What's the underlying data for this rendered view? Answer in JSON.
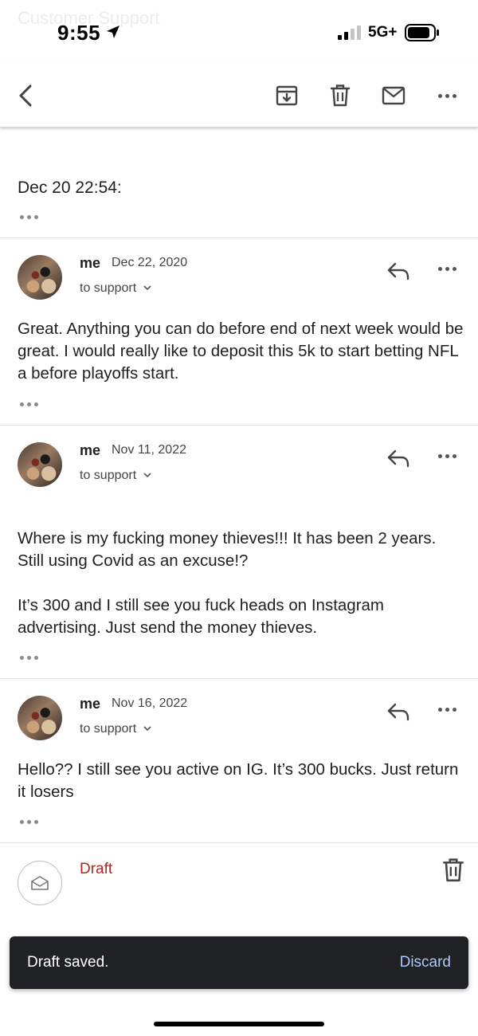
{
  "window": {
    "ghost_title": "Customer Support"
  },
  "status_bar": {
    "time": "9:55",
    "network": "5G+"
  },
  "toolbar": {
    "icons": [
      "back-arrow-icon",
      "archive-icon",
      "trash-icon",
      "mail-icon",
      "more-icon"
    ]
  },
  "thread": {
    "collapsed_header": "Dec 20 22:54:",
    "messages": [
      {
        "sender": "me",
        "date": "Dec 22, 2020",
        "to": "to support",
        "body": "Great. Anything you can do before end of next week would be great. I would really like to deposit this 5k to start betting NFL a before playoffs start."
      },
      {
        "sender": "me",
        "date": "Nov 11, 2022",
        "to": "to support",
        "body_p1": "Where is my fucking money thieves!!! It has been 2 years. Still using Covid as an excuse!?",
        "body_p2": "It’s 300 and I still see you fuck heads on Instagram advertising. Just send the money thieves."
      },
      {
        "sender": "me",
        "date": "Nov 16, 2022",
        "to": "to support",
        "body": "Hello?? I still see you active on IG. It’s 300 bucks. Just return it losers"
      }
    ]
  },
  "draft": {
    "label": "Draft",
    "label_color": "#b3261e"
  },
  "snackbar": {
    "message": "Draft saved.",
    "action": "Discard",
    "action_color": "#a8c7fa"
  }
}
